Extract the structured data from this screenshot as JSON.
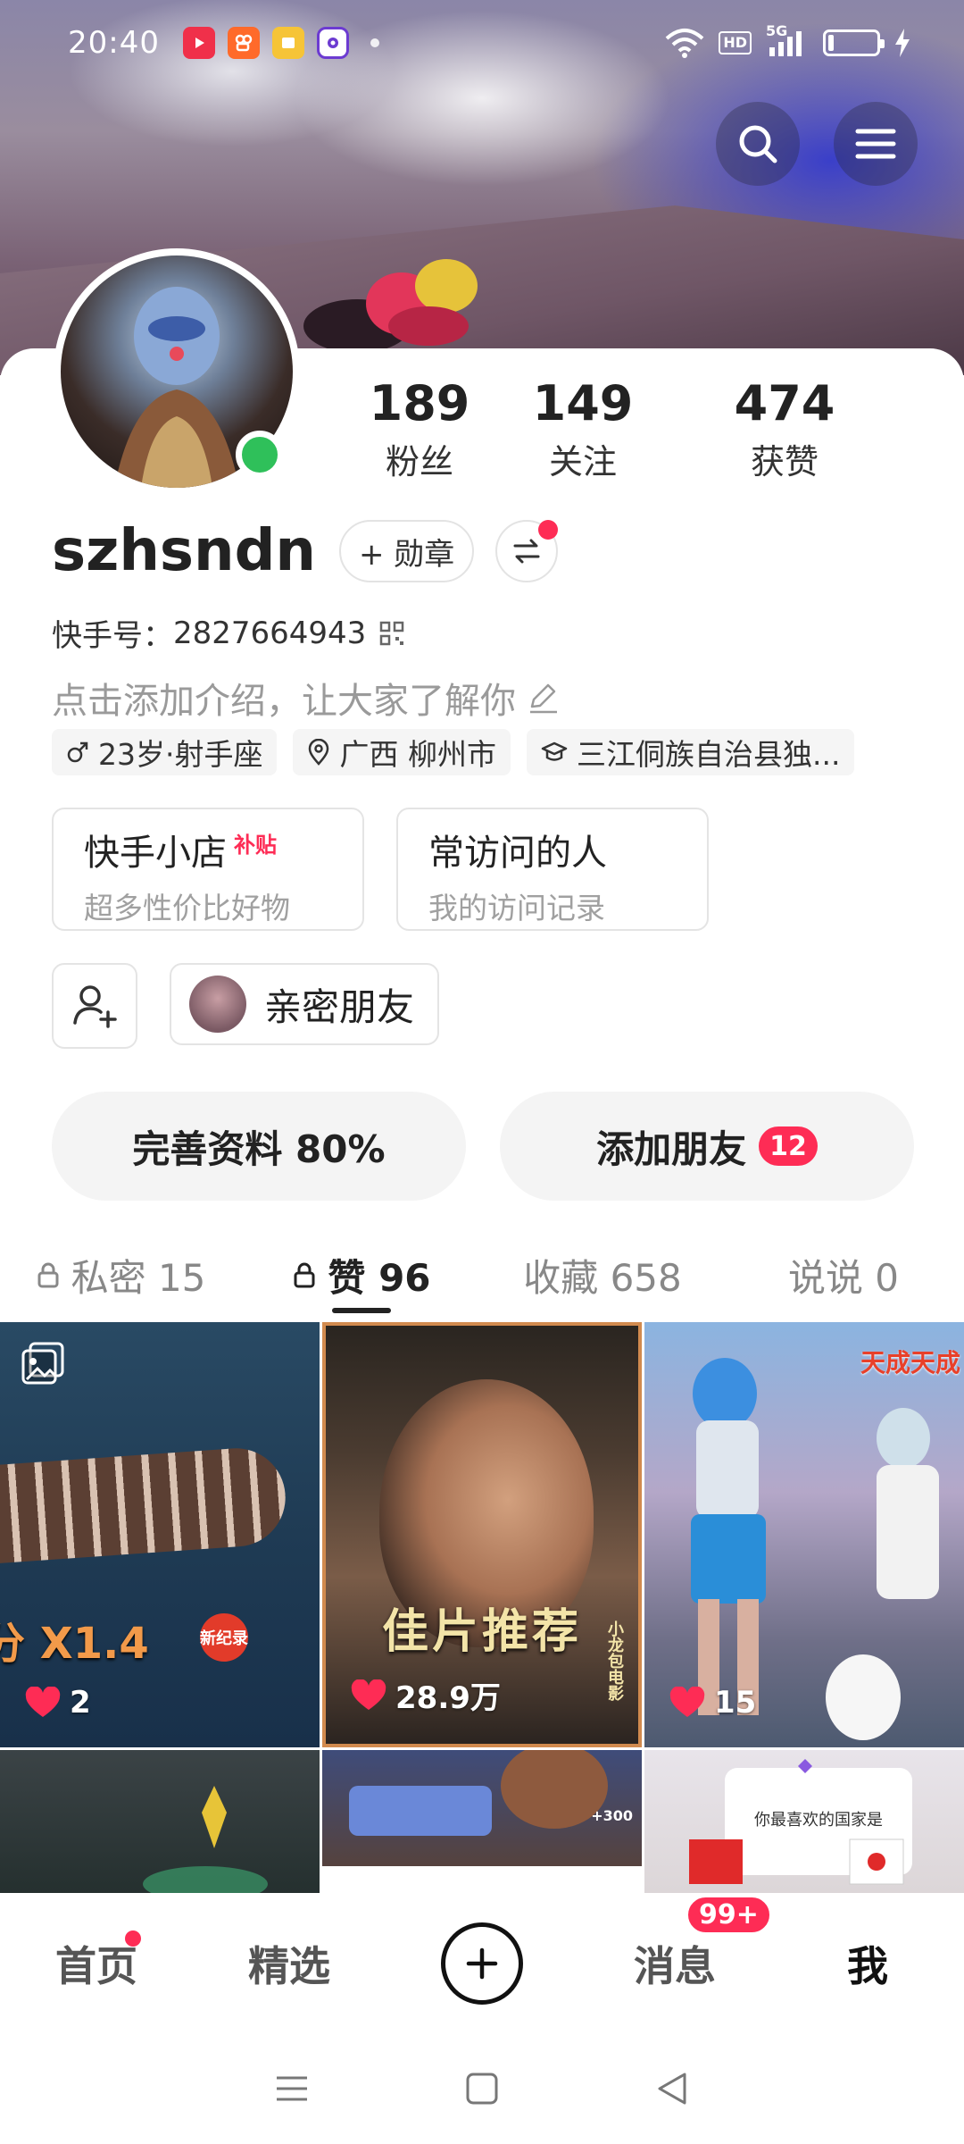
{
  "status_bar": {
    "time": "20:40",
    "hd": "HD",
    "network": "5G",
    "notification_icons": [
      "video-app-icon",
      "kuaishou-icon",
      "notes-icon",
      "browser-icon"
    ]
  },
  "profile": {
    "stats": [
      {
        "value": "189",
        "label": "粉丝"
      },
      {
        "value": "149",
        "label": "关注"
      },
      {
        "value": "474",
        "label": "获赞"
      }
    ],
    "username": "szhsndn",
    "badge_button": "+ 勋章",
    "uid_label": "快手号：",
    "uid": "2827664943",
    "intro_placeholder": "点击添加介绍，让大家了解你",
    "tags": [
      {
        "icon": "male-icon",
        "text": "23岁·射手座"
      },
      {
        "icon": "location-icon",
        "text": "广西 柳州市"
      },
      {
        "icon": "school-icon",
        "text": "三江侗族自治县独..."
      }
    ],
    "shop": {
      "title": "快手小店",
      "tag": "补贴",
      "subtitle": "超多性价比好物"
    },
    "visitors": {
      "title": "常访问的人",
      "subtitle": "我的访问记录"
    },
    "close_friends": "亲密朋友",
    "complete_profile": "完善资料 80%",
    "add_friends": "添加朋友",
    "add_friends_count": "12"
  },
  "tabs": [
    {
      "label": "私密 15",
      "locked": true
    },
    {
      "label": "赞 96",
      "locked": true,
      "active": true
    },
    {
      "label": "收藏 658",
      "locked": false
    },
    {
      "label": "说说 0",
      "locked": false
    }
  ],
  "grid": [
    {
      "likes": "2",
      "overlay": "分 X1.4",
      "sticker": "新纪录"
    },
    {
      "likes": "28.9万",
      "overlay": "佳片推荐",
      "side_text": "小龙包电影"
    },
    {
      "likes": "15",
      "overlay": "天成天成"
    },
    {},
    {
      "overlay": "+300"
    },
    {
      "overlay": "你最喜欢的国家是"
    }
  ],
  "bottom_nav": {
    "home": "首页",
    "featured": "精选",
    "messages": "消息",
    "messages_badge": "99+",
    "me": "我"
  },
  "colors": {
    "accent": "#fe2c55",
    "online": "#2fc05a",
    "text_primary": "#222222",
    "text_secondary": "#9a9a9a"
  }
}
